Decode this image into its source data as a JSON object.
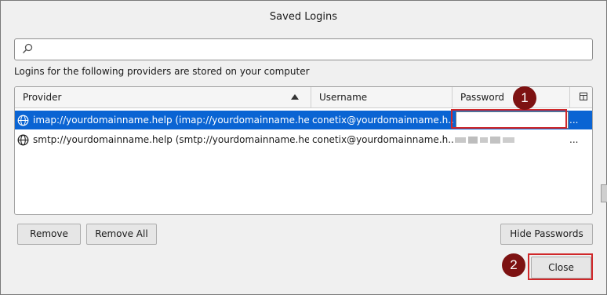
{
  "window": {
    "title": "Saved Logins"
  },
  "search": {
    "placeholder": "",
    "value": ""
  },
  "description": "Logins for the following providers are stored on your computer",
  "table": {
    "columns": {
      "provider": "Provider",
      "username": "Username",
      "password": "Password"
    },
    "sort": {
      "column": "Provider",
      "direction": "ascending"
    },
    "rows": [
      {
        "provider": "imap://yourdomainname.help (imap://yourdomainname.he...",
        "username": "conetix@yourdomainname.h...",
        "password": "",
        "overflow": "...",
        "selected": true
      },
      {
        "provider": "smtp://yourdomainname.help (smtp://yourdomainname.he...",
        "username": "conetix@yourdomainname.h...",
        "password": "",
        "overflow": "...",
        "selected": false
      }
    ]
  },
  "buttons": {
    "remove": "Remove",
    "remove_all": "Remove All",
    "hide_passwords": "Hide Passwords",
    "close": "Close"
  },
  "annotations": {
    "badge1": "1",
    "badge2": "2"
  },
  "colors": {
    "selection": "#0a64d3",
    "highlight": "#d0282a",
    "badge": "#7d1212"
  },
  "icons": {
    "search": "search-icon",
    "globe": "globe-icon",
    "column_picker": "column-picker-icon"
  }
}
